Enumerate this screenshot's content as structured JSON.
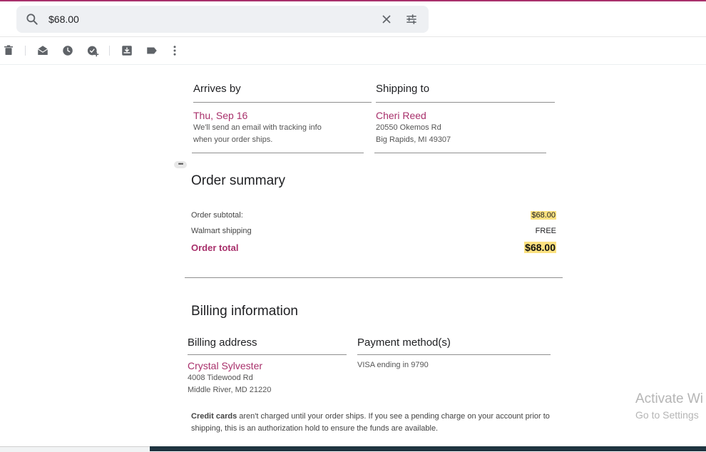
{
  "search": {
    "query": "$68.00"
  },
  "toolbar": {
    "icons": [
      "trash-icon",
      "mark-read-icon",
      "snooze-icon",
      "add-task-icon",
      "move-to-icon",
      "label-icon",
      "more-vert-icon"
    ]
  },
  "arrives": {
    "heading": "Arrives by",
    "date": "Thu, Sep 16",
    "note_line1": "We'll send an email with tracking info",
    "note_line2": "when your order ships."
  },
  "shipping": {
    "heading": "Shipping to",
    "name": "Cheri Reed",
    "address_line1": "20550 Okemos Rd",
    "address_line2": "Big Rapids, MI 49307"
  },
  "summary": {
    "title": "Order summary",
    "subtotal_label": "Order subtotal:",
    "subtotal_value": "$68.00",
    "shipping_label": "Walmart shipping",
    "shipping_value": "FREE",
    "total_label": "Order total",
    "total_value": "$68.00",
    "more_glyph": "•••"
  },
  "billing": {
    "title": "Billing information",
    "address_heading": "Billing address",
    "name": "Crystal Sylvester",
    "address_line1": "4008 Tidewood Rd",
    "address_line2": "Middle River, MD 21220",
    "payment_heading": "Payment method(s)",
    "payment_text": "VISA ending in 9790"
  },
  "disclaimer": {
    "bold": "Credit cards",
    "rest": " aren't charged until your order ships. If you see a pending charge on your account prior to shipping, this is an authorization hold to ensure the funds are available."
  },
  "watermark": {
    "line1": "Activate Wi",
    "line2": "Go to Settings"
  },
  "colors": {
    "accent": "#a8306b",
    "highlight": "#fbe17f"
  }
}
